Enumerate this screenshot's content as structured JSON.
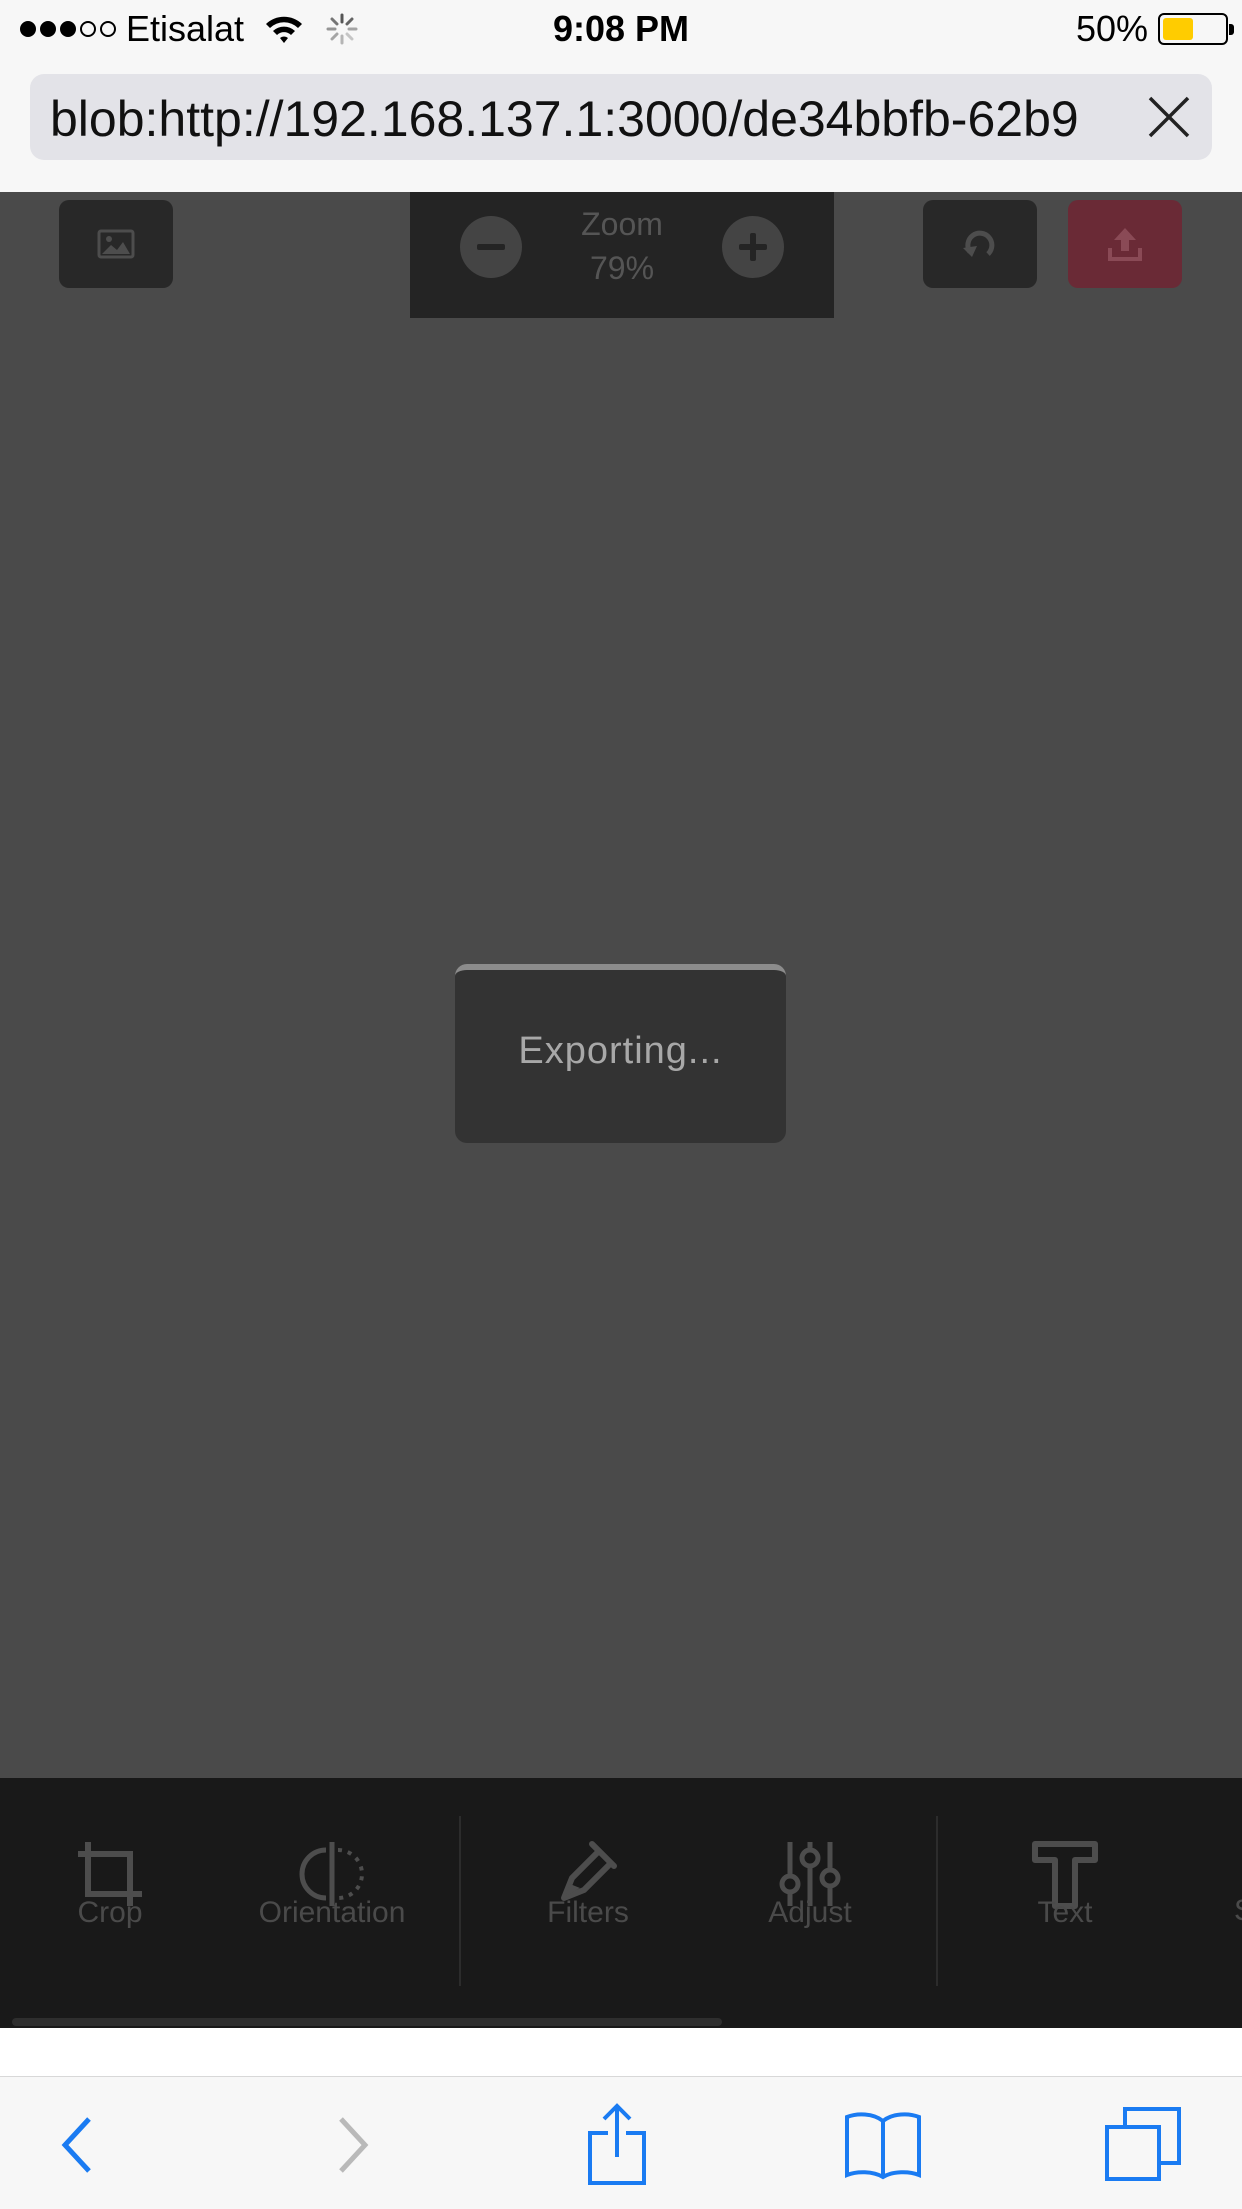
{
  "status_bar": {
    "carrier": "Etisalat",
    "time": "9:08 PM",
    "battery_percent": "50%",
    "battery_level": 0.5,
    "signal_bars_filled": 3,
    "signal_bars_total": 5
  },
  "browser": {
    "url": "blob:http://192.168.137.1:3000/de34bbfb-62b9"
  },
  "editor": {
    "zoom_title": "Zoom",
    "zoom_value": "79%",
    "dialog_text": "Exporting...",
    "tools": [
      {
        "label": "Crop",
        "icon": "crop-icon"
      },
      {
        "label": "Orientation",
        "icon": "orientation-icon"
      },
      {
        "label": "Filters",
        "icon": "filters-icon"
      },
      {
        "label": "Adjust",
        "icon": "adjust-icon"
      },
      {
        "label": "Text",
        "icon": "text-icon"
      }
    ]
  },
  "colors": {
    "canvas": "#4a4a4a",
    "export_button": "#6a2a36",
    "safari_accent": "#1a7bf2",
    "battery_fill": "#ffcc00"
  }
}
